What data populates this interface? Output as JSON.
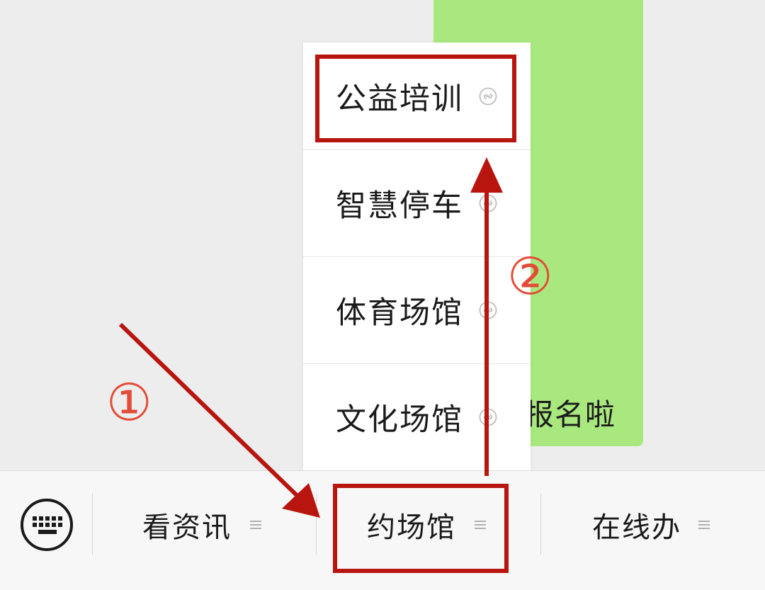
{
  "chat": {
    "bubble_text": "报名啦",
    "bubble_color": "#a9e87e"
  },
  "popup_menu": {
    "items": [
      {
        "label": "公益培训",
        "icon": "mini-program-link-icon"
      },
      {
        "label": "智慧停车",
        "icon": "mini-program-link-icon"
      },
      {
        "label": "体育场馆",
        "icon": "mini-program-link-icon"
      },
      {
        "label": "文化场馆",
        "icon": "mini-program-link-icon"
      }
    ]
  },
  "bottom_bar": {
    "keyboard_icon": "keyboard-icon",
    "tabs": [
      {
        "label": "看资讯",
        "icon": "menu-lines-icon"
      },
      {
        "label": "约场馆",
        "icon": "menu-lines-icon"
      },
      {
        "label": "在线办",
        "icon": "menu-lines-icon"
      }
    ]
  },
  "annotations": {
    "step1": "①",
    "step2": "②",
    "highlight_color": "#b8150f",
    "label_color": "#e34b36"
  }
}
